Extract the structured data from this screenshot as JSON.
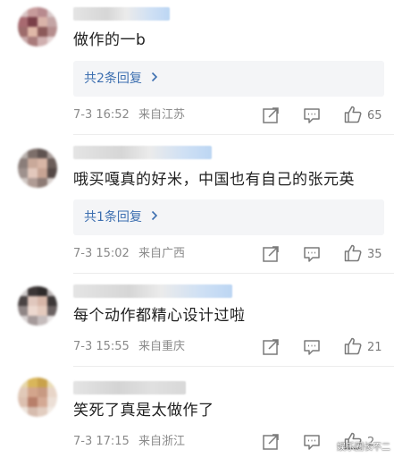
{
  "comments": [
    {
      "text": "做作的一b",
      "reply_label": "共2条回复",
      "time": "7-3 16:52",
      "location": "来自江苏",
      "likes": "65"
    },
    {
      "text": "哦买嘎真的好米，中国也有自己的张元英",
      "reply_label": "共1条回复",
      "time": "7-3 15:02",
      "location": "来自广西",
      "likes": "35"
    },
    {
      "text": "每个动作都精心设计过啦",
      "time": "7-3 15:55",
      "location": "来自重庆",
      "likes": "21"
    },
    {
      "text": "笑死了真是太做作了",
      "time": "7-3 17:15",
      "location": "来自浙江",
      "likes": "2"
    }
  ],
  "icons": {
    "reply_arrow": "chevron-right-icon",
    "share": "share-icon",
    "comment": "comment-icon",
    "like": "thumbs-up-icon"
  },
  "colors": {
    "link": "#3d6fb0",
    "meta": "#8a8a8a",
    "reply_bg": "#f4f5f7"
  },
  "watermark": "娱乐圈长不二"
}
